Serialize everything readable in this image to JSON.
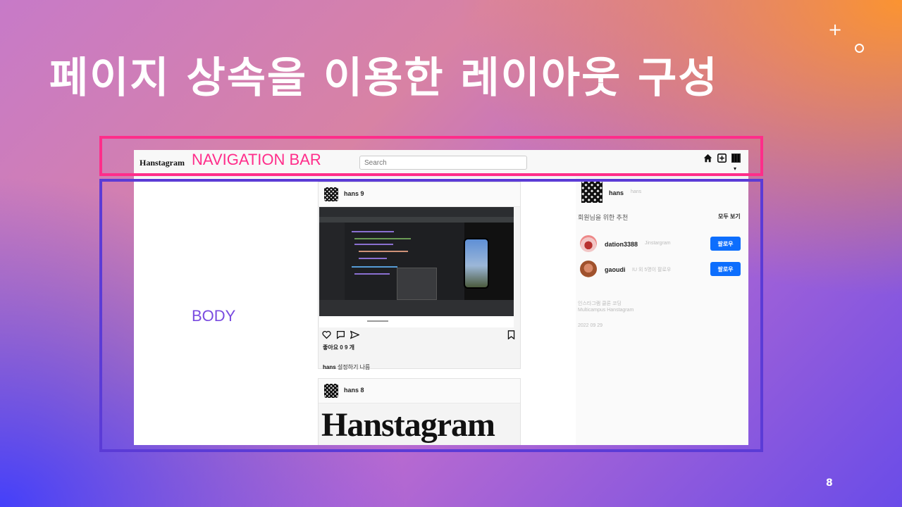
{
  "slide": {
    "title": "페이지 상속을 이용한 레이아웃 구성",
    "page_number": "8",
    "deco_plus": "+"
  },
  "labels": {
    "nav": "NAVIGATION BAR",
    "body": "BODY"
  },
  "app": {
    "brand": "Hanstagram",
    "search_placeholder": "Search",
    "nav_icons": [
      "home-icon",
      "add-icon",
      "profile-qr-icon"
    ],
    "caret": "▾"
  },
  "feed": {
    "posts": [
      {
        "user": "hans 9",
        "likes": "좋아요 0 9 개",
        "caption_user": "hans",
        "caption_text": "설정하기 나름"
      },
      {
        "user": "hans 8",
        "image_text": "Hanstagram"
      }
    ],
    "action_icons": [
      "heart-icon",
      "comment-icon",
      "send-icon",
      "bookmark-icon"
    ]
  },
  "sidebar": {
    "me": {
      "name": "hans",
      "sub": "hans"
    },
    "recommend_title": "회원님을 위한 추천",
    "see_all": "모두 보기",
    "suggestions": [
      {
        "name": "dation3388",
        "sub": "Jinstargram",
        "follow": "팔로우"
      },
      {
        "name": "gaoudi",
        "sub": "IU 외 5명이 팔로우",
        "follow": "팔로우"
      }
    ],
    "footer": {
      "line1": "인스타그램 클론 코딩",
      "line2": "Multicampus Hanstagram",
      "date": "2022 09 29"
    }
  },
  "colors": {
    "nav_box": "#ff2d8a",
    "body_box": "#5b3bd6",
    "follow_button": "#0d6efd"
  }
}
